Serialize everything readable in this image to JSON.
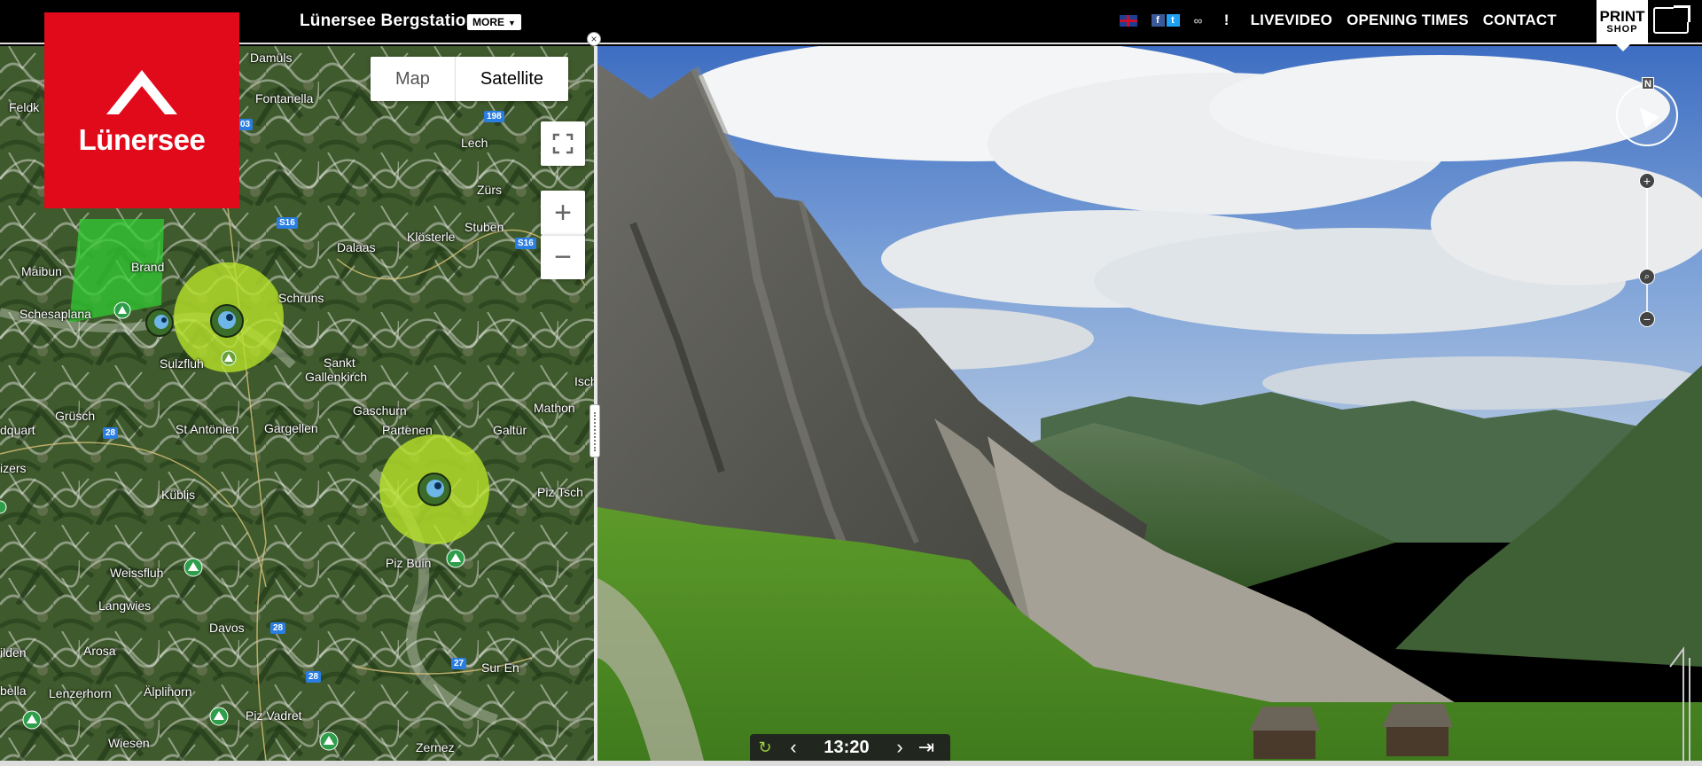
{
  "header": {
    "logo_text": "Lünersee",
    "camera_title": "Lünersee Bergstation",
    "more_label": "MORE",
    "flag_icon": "uk-flag-icon",
    "social_icons": [
      "facebook-icon",
      "twitter-icon"
    ],
    "link_icon": "link-icon",
    "info_label": "!",
    "nav": [
      "LIVEVIDEO",
      "OPENING TIMES",
      "CONTACT"
    ],
    "print_label": "PRINT",
    "print_sub": "SHOP"
  },
  "map": {
    "type_buttons": {
      "map": "Map",
      "satellite": "Satellite"
    },
    "controls": {
      "fullscreen_icon": "fullscreen-icon",
      "zoom_in": "+",
      "zoom_out": "−"
    },
    "close_label": "×",
    "labels": [
      "Damüls",
      "Fontanella",
      "Feldk",
      "Lech",
      "Zürs",
      "Stuben",
      "Klösterle",
      "Dalaas",
      "Maibun",
      "Brand",
      "Schesaplana",
      "Schruns",
      "Sulzfluh",
      "Sankt",
      "Gallenkirch",
      "Gaschurn",
      "Partenen",
      "Galtür",
      "Mathon",
      "Isch",
      "Grüsch",
      "St Antönien",
      "Gargellen",
      "dquart",
      "izers",
      "Küblis",
      "Weissfluh",
      "Langwies",
      "Davos",
      "Arosa",
      "Sur En",
      "Piz Buin",
      "Piz Tsch",
      "Lenzerhorn",
      "Älplihorn",
      "Piz Vadret",
      "Zernez",
      "Wiesen",
      "ilden",
      "bella"
    ],
    "roads": [
      "198",
      "S16",
      "S16",
      "28",
      "28",
      "28",
      "27",
      "03"
    ],
    "accent_colors": {
      "camera_zone": "#b8e22a",
      "sector": "#33cc33",
      "road": "#2a7de1"
    }
  },
  "viewer": {
    "time": "13:20",
    "compass_label": "N",
    "zoom_in": "+",
    "zoom_out": "−",
    "zoom_icon": "magnifier-icon",
    "loop_icon": "loop-icon"
  }
}
